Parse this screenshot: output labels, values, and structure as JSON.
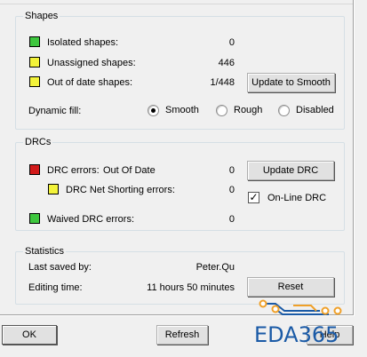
{
  "shapes": {
    "title": "Shapes",
    "rows": [
      {
        "label": "Isolated shapes:",
        "value": "0",
        "color": "#3ec73e"
      },
      {
        "label": "Unassigned shapes:",
        "value": "446",
        "color": "#f3f33a"
      },
      {
        "label": "Out of date shapes:",
        "value": "1/448",
        "color": "#f3f33a"
      }
    ],
    "update_button": "Update to Smooth",
    "dynamic_fill_label": "Dynamic fill:",
    "fill_options": [
      {
        "label": "Smooth",
        "selected": true
      },
      {
        "label": "Rough",
        "selected": false
      },
      {
        "label": "Disabled",
        "selected": false
      }
    ]
  },
  "drcs": {
    "title": "DRCs",
    "errors_label": "DRC errors:",
    "errors_status": "Out Of Date",
    "errors_value": "0",
    "net_shorting_label": "DRC Net Shorting errors:",
    "net_shorting_value": "0",
    "waived_label": "Waived DRC errors:",
    "waived_value": "0",
    "update_button": "Update DRC",
    "online_label": "On-Line DRC",
    "online_checked": true,
    "colors": {
      "error": "#d21a1a",
      "net": "#f3f33a",
      "waived": "#3ec73e"
    }
  },
  "statistics": {
    "title": "Statistics",
    "last_saved_label": "Last saved by:",
    "last_saved_value": "Peter.Qu",
    "editing_time_label": "Editing time:",
    "editing_time_value": "11 hours 50 minutes",
    "reset_button": "Reset"
  },
  "footer": {
    "ok_button": "OK",
    "refresh_button": "Refresh",
    "help_button": "Help"
  },
  "watermark": {
    "text": "EDA365",
    "color": "#1a5aa6",
    "accent": "#f0a028"
  }
}
